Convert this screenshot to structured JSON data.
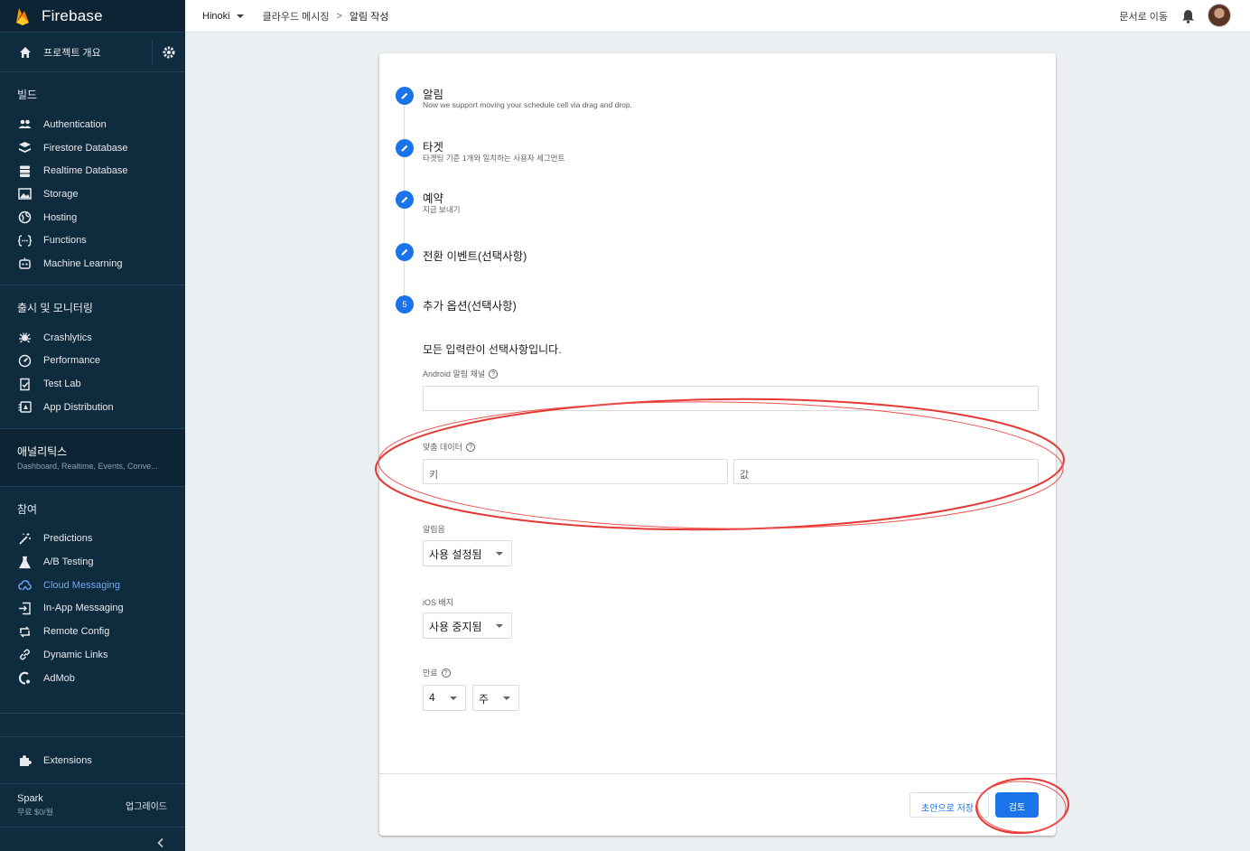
{
  "brand": {
    "name": "Firebase"
  },
  "sidebar": {
    "overview_label": "프로젝트 개요",
    "build": {
      "title": "빌드",
      "items": [
        {
          "label": "Authentication",
          "icon": "users-icon"
        },
        {
          "label": "Firestore Database",
          "icon": "firestore-icon"
        },
        {
          "label": "Realtime Database",
          "icon": "database-icon"
        },
        {
          "label": "Storage",
          "icon": "image-icon"
        },
        {
          "label": "Hosting",
          "icon": "globe-icon"
        },
        {
          "label": "Functions",
          "icon": "functions-icon"
        },
        {
          "label": "Machine Learning",
          "icon": "robot-icon"
        }
      ]
    },
    "release": {
      "title": "출시 및 모니터링",
      "items": [
        {
          "label": "Crashlytics",
          "icon": "crashlytics-icon"
        },
        {
          "label": "Performance",
          "icon": "speedometer-icon"
        },
        {
          "label": "Test Lab",
          "icon": "checklist-icon"
        },
        {
          "label": "App Distribution",
          "icon": "distribution-icon"
        }
      ]
    },
    "analytics": {
      "title": "애널리틱스",
      "subtitle": "Dashboard, Realtime, Events, Conve..."
    },
    "engage": {
      "title": "참여",
      "items": [
        {
          "label": "Predictions",
          "icon": "magic-wand-icon"
        },
        {
          "label": "A/B Testing",
          "icon": "flask-icon"
        },
        {
          "label": "Cloud Messaging",
          "icon": "cloud-messaging-icon",
          "active": true
        },
        {
          "label": "In-App Messaging",
          "icon": "in-app-icon"
        },
        {
          "label": "Remote Config",
          "icon": "remote-config-icon"
        },
        {
          "label": "Dynamic Links",
          "icon": "link-icon"
        },
        {
          "label": "AdMob",
          "icon": "admob-icon"
        }
      ]
    },
    "extensions_label": "Extensions",
    "plan": {
      "name": "Spark",
      "price": "무료 $0/월",
      "upgrade": "업그레이드"
    }
  },
  "topbar": {
    "project": "Hinoki",
    "crumb1": "클라우드 메시징",
    "separator": ">",
    "current": "알림 작성",
    "docs": "문서로 이동"
  },
  "steps": [
    {
      "title": "알림",
      "subtitle": "Now we support moving your schedule cell via drag and drop."
    },
    {
      "title": "타겟",
      "subtitle": "타겟팅 기준 1개와 일치하는 사용자 세그먼트"
    },
    {
      "title": "예약",
      "subtitle": "지금 보내기"
    },
    {
      "title": "전환 이벤트(선택사항)",
      "subtitle": ""
    },
    {
      "title": "추가 옵션(선택사항)",
      "number": "5"
    }
  ],
  "form": {
    "intro": "모든 입력란이 선택사항입니다.",
    "android_channel_label": "Android 알림 채널",
    "android_channel_value": "",
    "custom_data_label": "맞춤 데이터",
    "key_placeholder": "키",
    "value_placeholder": "값",
    "sound_label": "알림음",
    "sound_value": "사용 설정됨",
    "ios_badge_label": "iOS 배지",
    "ios_badge_value": "사용 중지됨",
    "expiry_label": "만료",
    "expiry_amount": "4",
    "expiry_unit": "주"
  },
  "footer": {
    "draft_label": "초안으로 저장",
    "review_label": "검토"
  },
  "annotation_color": "#e53935",
  "accent_color": "#1a73e8"
}
